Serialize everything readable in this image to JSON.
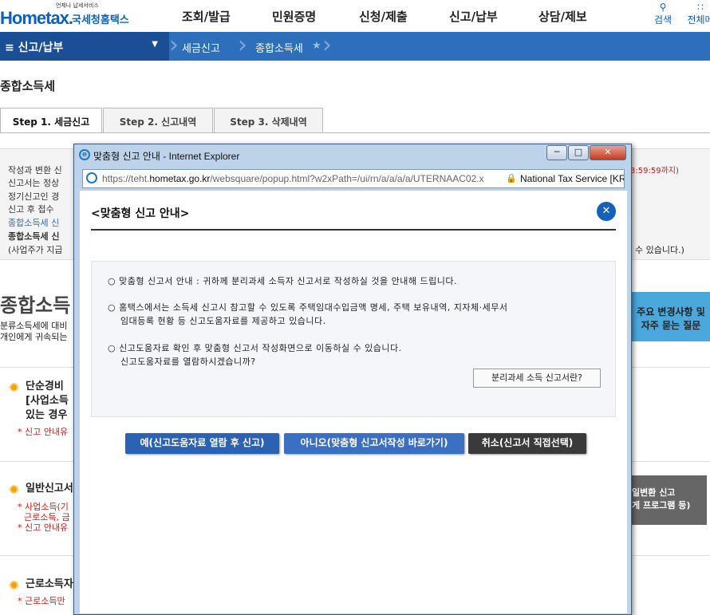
{
  "topbar": {
    "logo_tagline": "언제나 납세서비스",
    "logo_brand": "Hometax.",
    "logo_kr": "국세청홈택스",
    "nav": [
      "조회/발급",
      "민원증명",
      "신청/제출",
      "신고/납부",
      "상담/제보"
    ],
    "search_label": "검색",
    "allmenu_label": "전체메"
  },
  "breadcrumb": {
    "menu": "신고/납부",
    "items": [
      "세금신고",
      "종합소득세"
    ]
  },
  "page": {
    "title": "종합소득세",
    "tabs": [
      "Step 1. 세금신고",
      "Step 2. 신고내역",
      "Step 3. 삭제내역"
    ]
  },
  "info": {
    "lines": [
      "작성과 변환 신",
      "신고서는 정상",
      "정기신고인 경",
      "신고 후 접수",
      "종합소득세 신",
      "종합소득세 신",
      "(사업주가 지급"
    ],
    "right_red": "3:59:59까지)",
    "right_tail": "수 있습니다.)"
  },
  "section": {
    "big_title": "종합소득",
    "desc1": "분류소득세에 대비",
    "desc2": "개인에게 귀속되는",
    "right_btn_1": "주요 변경사항 및",
    "right_btn_2": "자주 묻는 질문",
    "s1_title_a": "단순경비",
    "s1_title_b": "[사업소득",
    "s1_title_c": "있는 경우",
    "s1_note": "* 신고 안내유",
    "s2_title": "일반신고서",
    "s2_note_a": "* 사업소득(기",
    "s2_note_b": "근로소득, 금",
    "s2_note_c": "* 신고 안내유",
    "s2_btn_a": "일변환 신고",
    "s2_btn_b": "게 프로그램 등)",
    "s3_title": "근로소득자",
    "s3_note": "* 근로소득만"
  },
  "popup": {
    "window_title": "맞춤형 신고 안내 - Internet Explorer",
    "url_prefix": "https://teht.",
    "url_host": "hometax.go.kr",
    "url_rest": "/websquare/popup.html?w2xPath=/ui/rn/a/a/a/a/UTERNAAC02.x",
    "site_owner": "National Tax Service [KR]",
    "title": "<맞춤형 신고 안내>",
    "items": [
      "○ 맞춤형 신고서 안내 : 귀하께 분리과세 소득자 신고서로 작성하실 것을 안내해 드립니다.",
      "○ 홈택스에서는 소득세 신고시 참고할 수 있도록 주택임대수입금액 명세, 주택 보유내역, 지자체·세무서",
      "임대등록 현황 등 신고도움자료를 제공하고 있습니다.",
      "○ 신고도움자료 확인 후 맞춤형 신고서 작성화면으로 이동하실 수 있습니다.",
      "신고도움자료를 열람하시겠습니까?"
    ],
    "info_button": "분리과세 소득 신고서란?",
    "btn_yes": "예(신고도움자료 열람 후 신고)",
    "btn_no": "아니오(맞춤형 신고서작성 바로가기)",
    "btn_cancel": "취소(신고서 직접선택)",
    "colors": {
      "yes": "#2b62b4",
      "no": "#3b6fc2",
      "cancel": "#3a3a3a"
    }
  }
}
